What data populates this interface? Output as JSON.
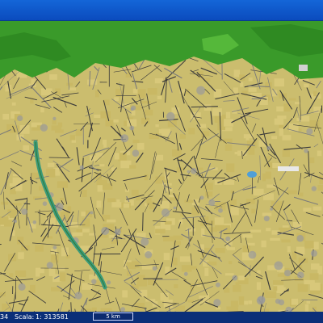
{
  "statusbar": {
    "coordinate_partial": "34",
    "scale_label": "Scala:",
    "scale_value": "1: 313581",
    "scalebar_label": "5 km"
  },
  "map": {
    "colors": {
      "urban_fill": "#d8c87a",
      "urban_fill_alt": "#c9b864",
      "road_dark": "#3a3a3a",
      "road_light": "#7a7a7a",
      "green_area": "#3a9a2a",
      "green_dark": "#1f5a18",
      "river": "#3c9a7a",
      "water_blue": "#4f9fd8",
      "building_gray": "#9a9a9a"
    }
  }
}
